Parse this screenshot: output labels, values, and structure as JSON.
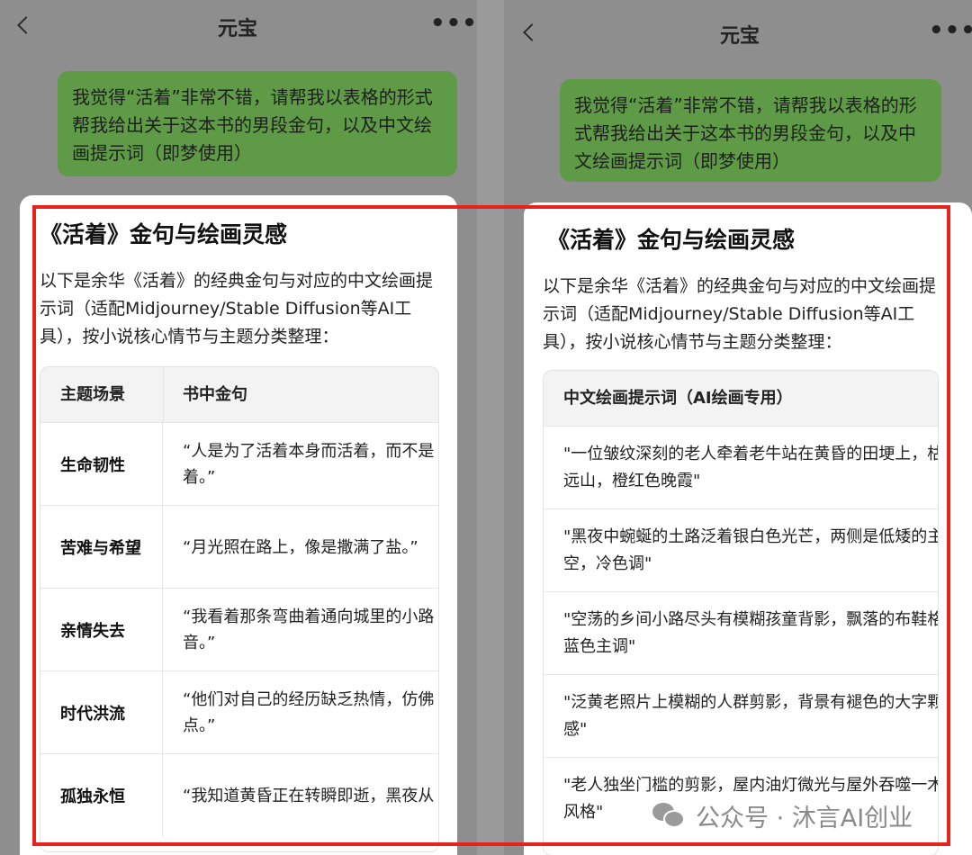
{
  "left": {
    "header": {
      "title": "元宝",
      "more": "•••"
    },
    "user_message": "我觉得“活着”非常不错，请帮我以表格的形式帮我给出关于这本书的男段金句，以及中文绘画提示词（即梦使用）",
    "response": {
      "title": "《活着》金句与绘画灵感",
      "intro": "以下是余华《活着》的经典金句与对应的中文绘画提示词（适配Midjourney/Stable Diffusion等AI工具），按小说核心情节与主题分类整理：",
      "table": {
        "headers": [
          "主题场景",
          "书中金句"
        ],
        "rows": [
          {
            "theme": "生命韧性",
            "quote": "“人是为了活着本身而活着，而不是着。”"
          },
          {
            "theme": "苦难与希望",
            "quote": "“月光照在路上，像是撒满了盐。”"
          },
          {
            "theme": "亲情失去",
            "quote": "“我看着那条弯曲着通向城里的小路音。”"
          },
          {
            "theme": "时代洪流",
            "quote": "“他们对自己的经历缺乏热情，仿佛点。”"
          },
          {
            "theme": "孤独永恒",
            "quote": "“我知道黄昏正在转瞬即逝，黑夜从"
          }
        ]
      }
    }
  },
  "right": {
    "header": {
      "title": "元宝",
      "more": "•••"
    },
    "user_message": "我觉得“活着”非常不错，请帮我以表格的形式帮我给出关于这本书的男段金句，以及中文绘画提示词（即梦使用）",
    "response": {
      "title": "《活着》金句与绘画灵感",
      "intro": "以下是余华《活着》的经典金句与对应的中文绘画提示词（适配Midjourney/Stable Diffusion等AI工具），按小说核心情节与主题分类整理：",
      "table": {
        "header": "中文绘画提示词（AI绘画专用）",
        "rows": [
          "\"一位皱纹深刻的老人牵着老牛站在黄昏的田埂上，枯树与远山，橙红色晚霞\"",
          "\"黑夜中蜿蜒的土路泛着银白色光芒，两侧是低矮的主义星空，冷色调\"",
          "\"空荡的乡间小路尽头有模糊孩童背影，飘落的布鞋格，灰蓝色主调\"",
          "\"泛黄老照片上模糊的人群剪影，背景有褪色的大字颗粒质感\"",
          "\"老人独坐门槛的剪影，屋内油灯微光与屋外吞噬一木版画风格\""
        ]
      }
    }
  },
  "watermark": {
    "text": "公众号 · 沐言AI创业",
    "icon": "wechat-icon"
  },
  "colors": {
    "highlight": "#e8231c",
    "bubble": "#5f9b46"
  }
}
